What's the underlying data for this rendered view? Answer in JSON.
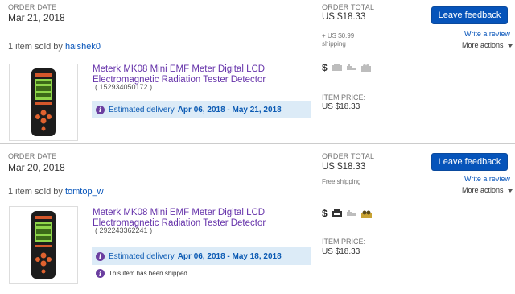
{
  "orders": [
    {
      "order_date_label": "ORDER DATE",
      "order_date": "Mar 21, 2018",
      "sold_by_prefix": "1 item sold by",
      "seller": "haishek0",
      "order_total_label": "ORDER TOTAL",
      "order_total": "US $18.33",
      "shipping": "+ US $0.99\nshipping",
      "leave_feedback": "Leave feedback",
      "write_review": "Write a review",
      "more_actions": "More actions",
      "item_title": "Meterk MK08 Mini EMF Meter Digital LCD Electromagnetic Radiation Tester Detector",
      "item_number": "( 152934050172 )",
      "delivery_label": "Estimated delivery",
      "delivery_dates": "Apr 06, 2018 - May 21, 2018",
      "item_price_label": "ITEM PRICE:",
      "item_price": "US $18.33",
      "status_icons": [
        "dollar-icon",
        "printer-icon",
        "ship-icon",
        "feedback-icon"
      ]
    },
    {
      "order_date_label": "ORDER DATE",
      "order_date": "Mar 20, 2018",
      "sold_by_prefix": "1 item sold by",
      "seller": "tomtop_w",
      "order_total_label": "ORDER TOTAL",
      "order_total": "US $18.33",
      "shipping": "Free shipping",
      "leave_feedback": "Leave feedback",
      "write_review": "Write a review",
      "more_actions": "More actions",
      "item_title": "Meterk MK08 Mini EMF Meter Digital LCD Electromagnetic Radiation Tester Detector",
      "item_number": "( 292243362241 )",
      "delivery_label": "Estimated delivery",
      "delivery_dates": "Apr 06, 2018 - May 18, 2018",
      "item_price_label": "ITEM PRICE:",
      "item_price": "US $18.33",
      "shipped_note": "This item has been shipped.",
      "status_icons": [
        "dollar-icon",
        "printer-icon",
        "ship-icon",
        "feedback-icon"
      ]
    }
  ],
  "colors": {
    "link": "#0654ba",
    "visited_link": "#6633aa",
    "button": "#0654ba",
    "delivery_bg": "#dcebf7",
    "info_icon": "#6b3fa0"
  }
}
